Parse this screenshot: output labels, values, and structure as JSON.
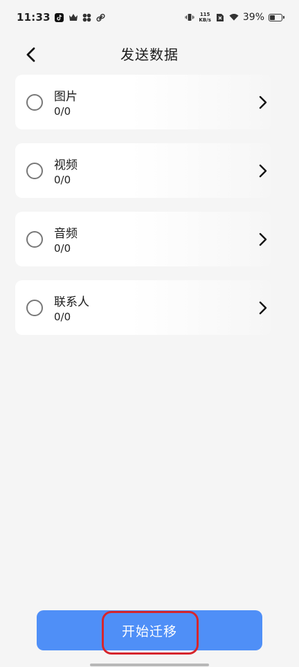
{
  "status_bar": {
    "time": "11:33",
    "net_speed_value": "115",
    "net_speed_unit": "KB/s",
    "battery_percent": "39%",
    "battery_level": 0.39,
    "icons": [
      "tiktok-icon",
      "crown-icon",
      "app-icon",
      "link-icon",
      "vibrate-icon",
      "sim-off-icon",
      "wifi-icon",
      "battery-icon"
    ]
  },
  "header": {
    "title": "发送数据",
    "back_icon": "chevron-left-icon"
  },
  "items": [
    {
      "label": "图片",
      "count": "0/0",
      "selected": false
    },
    {
      "label": "视频",
      "count": "0/0",
      "selected": false
    },
    {
      "label": "音频",
      "count": "0/0",
      "selected": false
    },
    {
      "label": "联系人",
      "count": "0/0",
      "selected": false
    }
  ],
  "footer": {
    "start_label": "开始迁移",
    "button_color": "#4f8ff7",
    "highlight_color": "#d6262d"
  }
}
